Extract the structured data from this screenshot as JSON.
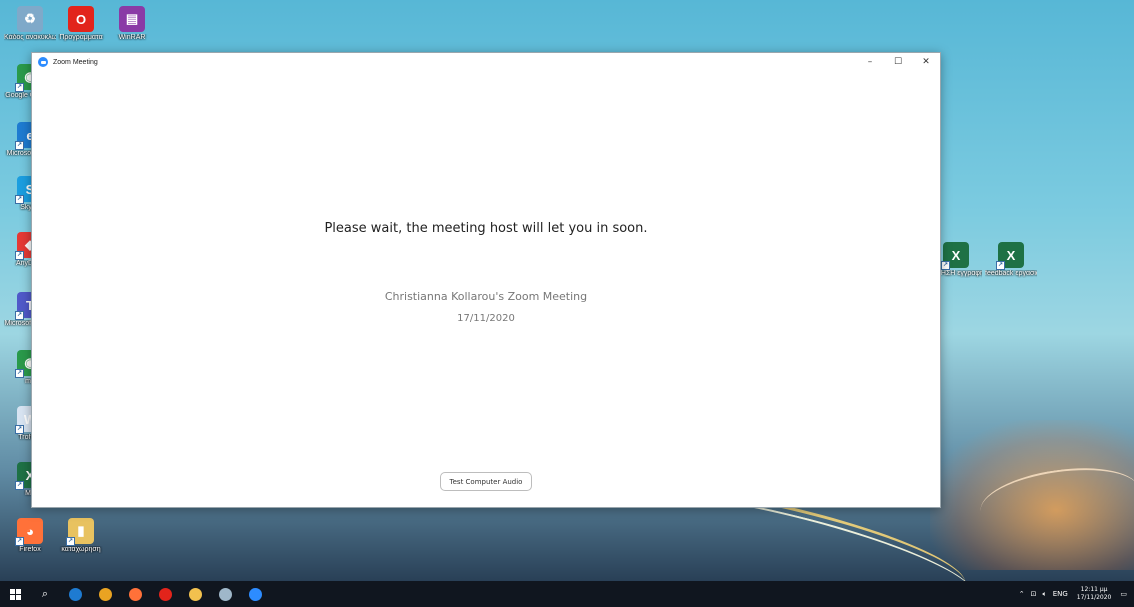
{
  "window": {
    "title": "Zoom Meeting",
    "minimize": "–",
    "maximize": "☐",
    "close": "✕"
  },
  "content": {
    "wait_message": "Please wait, the meeting host will let you in soon.",
    "meeting_name": "Christianna Kollarou's Zoom Meeting",
    "meeting_date": "17/11/2020",
    "audio_button": "Test Computer Audio"
  },
  "desktop": {
    "icons": [
      {
        "label": "Κάδος ανακύκλωσης",
        "icon": "recycle-bin-icon",
        "color": "#7fa9c9",
        "glyph": "♻"
      },
      {
        "label": "Προγράμματα",
        "icon": "opera-icon",
        "color": "#e2241b",
        "glyph": "O"
      },
      {
        "label": "WinRAR",
        "icon": "winrar-icon",
        "color": "#8a3aa6",
        "glyph": "▤"
      },
      {
        "label": "Google Chrome",
        "icon": "chrome-icon",
        "color": "#2a9a4b",
        "glyph": "◉"
      },
      {
        "label": "Microsoft Edge",
        "icon": "edge-icon",
        "color": "#1e7bd1",
        "glyph": "e"
      },
      {
        "label": "Skype",
        "icon": "skype-icon",
        "color": "#1b9ee0",
        "glyph": "S"
      },
      {
        "label": "AnyDesk",
        "icon": "anydesk-icon",
        "color": "#e53935",
        "glyph": "◆"
      },
      {
        "label": "Microsoft Teams",
        "icon": "teams-icon",
        "color": "#5059c9",
        "glyph": "T"
      },
      {
        "label": "ma",
        "icon": "chrome-icon",
        "color": "#2a9a4b",
        "glyph": "◉"
      },
      {
        "label": "Trofima",
        "icon": "word-doc-icon",
        "color": "#d8e4f2",
        "glyph": "W"
      },
      {
        "label": "Mn",
        "icon": "excel-icon",
        "color": "#1e7145",
        "glyph": "X"
      },
      {
        "label": "Firefox",
        "icon": "firefox-icon",
        "color": "#ff7139",
        "glyph": "◕"
      },
      {
        "label": "καταχώρηση",
        "icon": "folder-icon",
        "color": "#e8c260",
        "glyph": "▮"
      },
      {
        "label": "ΑΙΤΗΣΗ εγγραφής",
        "icon": "excel-icon",
        "color": "#1e7145",
        "glyph": "X"
      },
      {
        "label": "feedback εργασιών",
        "icon": "excel-icon",
        "color": "#1e7145",
        "glyph": "X"
      }
    ]
  },
  "taskbar": {
    "search_glyph": "⌕",
    "apps": [
      {
        "icon": "edge-icon",
        "color": "#1e7bd1"
      },
      {
        "icon": "chrome-icon",
        "color": "#e9a322"
      },
      {
        "icon": "firefox-icon",
        "color": "#ff7139"
      },
      {
        "icon": "opera-icon",
        "color": "#e2241b"
      },
      {
        "icon": "file-explorer-icon",
        "color": "#f2c14e"
      },
      {
        "icon": "paint-icon",
        "color": "#9fb7c9"
      },
      {
        "icon": "zoom-icon",
        "color": "#2d8cff"
      }
    ],
    "tray": {
      "language": "ENG",
      "time": "12:11 μμ",
      "date": "17/11/2020"
    }
  }
}
